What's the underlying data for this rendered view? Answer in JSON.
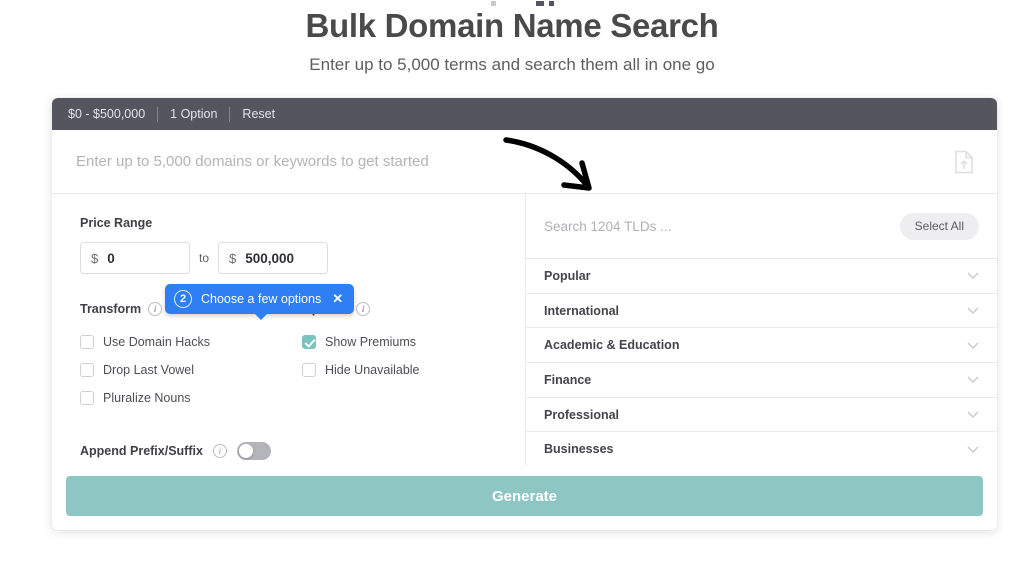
{
  "header": {
    "title": "Bulk Domain Name Search",
    "subtitle": "Enter up to 5,000 terms and search them all in one go"
  },
  "toolbar": {
    "price_summary": "$0 - $500,000",
    "option_count": "1 Option",
    "reset_label": "Reset"
  },
  "main_search": {
    "placeholder": "Enter up to 5,000 domains or keywords to get started",
    "value": "",
    "upload_icon": "file-upload-icon"
  },
  "tooltip": {
    "step_number": "2",
    "text": "Choose a few options",
    "close_icon": "close-icon",
    "color": "#2d7ff3"
  },
  "filters": {
    "price_range": {
      "label": "Price Range",
      "currency_symbol": "$",
      "min_value": "0",
      "max_value": "500,000",
      "separator": "to"
    },
    "transform": {
      "label": "Transform",
      "info_icon": "info-icon",
      "items": [
        {
          "label": "Use Domain Hacks",
          "checked": false
        },
        {
          "label": "Drop Last Vowel",
          "checked": false
        },
        {
          "label": "Pluralize Nouns",
          "checked": false
        }
      ]
    },
    "options": {
      "label": "Options",
      "info_icon": "info-icon",
      "items": [
        {
          "label": "Show Premiums",
          "checked": true
        },
        {
          "label": "Hide Unavailable",
          "checked": false
        }
      ]
    },
    "append": {
      "label": "Append Prefix/Suffix",
      "info_icon": "info-icon",
      "enabled": false
    }
  },
  "tld_panel": {
    "search_placeholder": "Search 1204 TLDs ...",
    "search_value": "",
    "select_all_label": "Select All",
    "categories": [
      {
        "label": "Popular"
      },
      {
        "label": "International"
      },
      {
        "label": "Academic & Education"
      },
      {
        "label": "Finance"
      },
      {
        "label": "Professional"
      },
      {
        "label": "Businesses"
      }
    ]
  },
  "footer": {
    "generate_label": "Generate"
  },
  "colors": {
    "accent_teal": "#8ec6c3",
    "checkbox_teal": "#79c3c0",
    "toolbar_dark": "#55555f",
    "tooltip_blue": "#2d7ff3"
  }
}
